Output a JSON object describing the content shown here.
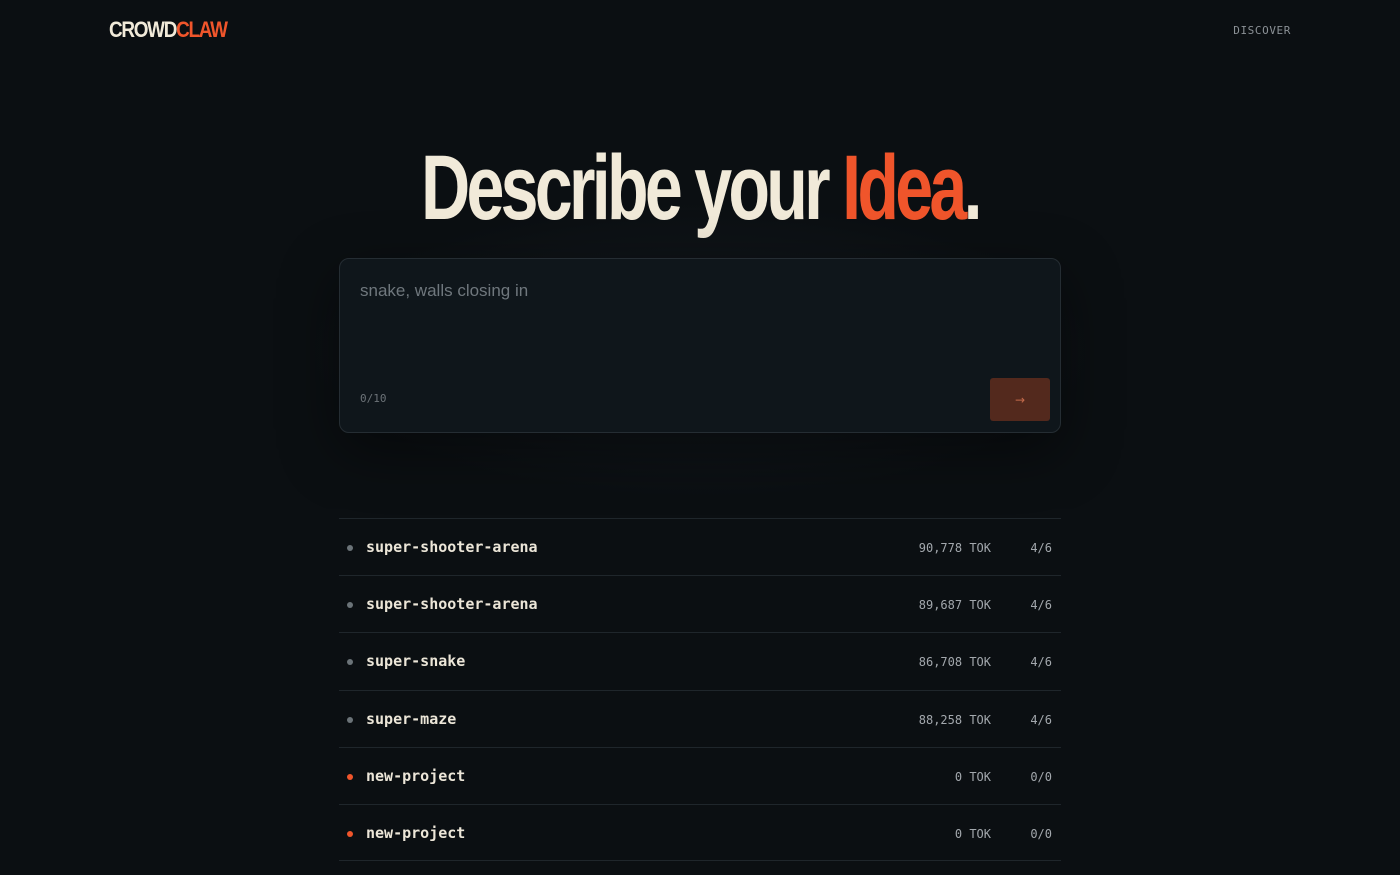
{
  "header": {
    "logo_part1": "CROWD",
    "logo_part2": "CLAW",
    "nav_discover": "DISCOVER"
  },
  "hero": {
    "word1": "Describe your ",
    "word2": "Idea",
    "punct": "."
  },
  "composer": {
    "placeholder": "snake, walls closing in",
    "value": "",
    "counter": "0/10",
    "submit_icon": "→"
  },
  "colors": {
    "accent": "#f0552b",
    "background": "#0b0f12",
    "bullet_inactive": "#6b7378",
    "bullet_active": "#f0552b"
  },
  "projects": [
    {
      "name": "super-shooter-arena",
      "tokens": "90,778 TOK",
      "ratio": "4/6",
      "status": "inactive"
    },
    {
      "name": "super-shooter-arena",
      "tokens": "89,687 TOK",
      "ratio": "4/6",
      "status": "inactive"
    },
    {
      "name": "super-snake",
      "tokens": "86,708 TOK",
      "ratio": "4/6",
      "status": "inactive"
    },
    {
      "name": "super-maze",
      "tokens": "88,258 TOK",
      "ratio": "4/6",
      "status": "inactive"
    },
    {
      "name": "new-project",
      "tokens": "0 TOK",
      "ratio": "0/0",
      "status": "active"
    },
    {
      "name": "new-project",
      "tokens": "0 TOK",
      "ratio": "0/0",
      "status": "active"
    }
  ]
}
